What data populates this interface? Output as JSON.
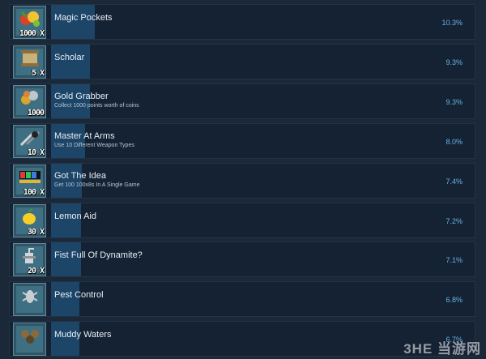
{
  "achievements": [
    {
      "title": "Magic Pockets",
      "description": "",
      "percent": "10.3%",
      "fraction": 0.103,
      "icon": "fruit-pile-icon",
      "multiplier": "1000 X"
    },
    {
      "title": "Scholar",
      "description": "",
      "percent": "9.3%",
      "fraction": 0.093,
      "icon": "scroll-icon",
      "multiplier": "5 X"
    },
    {
      "title": "Gold Grabber",
      "description": "Collect 1000 points worth of coins",
      "percent": "9.3%",
      "fraction": 0.093,
      "icon": "coins-icon",
      "multiplier": "1000"
    },
    {
      "title": "Master At Arms",
      "description": "Use 10 Different Weapon Types",
      "percent": "8.0%",
      "fraction": 0.08,
      "icon": "weapons-icon",
      "multiplier": "10 X"
    },
    {
      "title": "Got The Idea",
      "description": "Get 100 100x8s In A Single Game",
      "percent": "7.4%",
      "fraction": 0.074,
      "icon": "combo-counter-icon",
      "multiplier": "100 X"
    },
    {
      "title": "Lemon Aid",
      "description": "",
      "percent": "7.2%",
      "fraction": 0.072,
      "icon": "lemon-icon",
      "multiplier": "30 X"
    },
    {
      "title": "Fist Full Of Dynamite?",
      "description": "",
      "percent": "7.1%",
      "fraction": 0.071,
      "icon": "dynamite-icon",
      "multiplier": "20 X"
    },
    {
      "title": "Pest Control",
      "description": "",
      "percent": "6.8%",
      "fraction": 0.068,
      "icon": "bug-icon",
      "multiplier": ""
    },
    {
      "title": "Muddy Waters",
      "description": "",
      "percent": "6.7%",
      "fraction": 0.067,
      "icon": "mud-splash-icon",
      "multiplier": ""
    }
  ],
  "watermark": "3HE 当游网",
  "colors": {
    "background": "#1b2838",
    "row": "#152233",
    "bar": "#1d4568",
    "percent": "#65b3e6",
    "title": "#e6eef5"
  }
}
